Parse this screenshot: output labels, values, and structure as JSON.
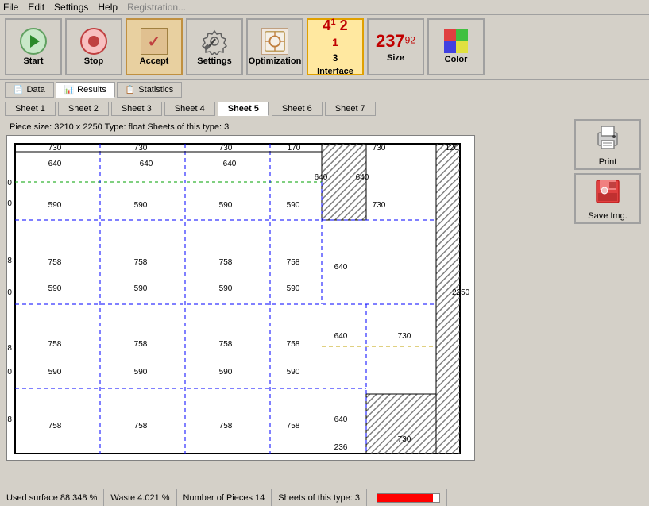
{
  "menu": {
    "items": [
      "File",
      "Edit",
      "Settings",
      "Help",
      "Registration..."
    ]
  },
  "toolbar": {
    "start": "Start",
    "stop": "Stop",
    "accept": "Accept",
    "settings": "Settings",
    "optimization": "Optimization",
    "interface": "Interface",
    "size": "Size",
    "color": "Color",
    "interface_numbers": "4 1 2\n1\n3"
  },
  "nav_tabs": {
    "items": [
      "Data",
      "Results",
      "Statistics"
    ]
  },
  "sheet_tabs": {
    "items": [
      "Sheet 1",
      "Sheet 2",
      "Sheet 3",
      "Sheet 4",
      "Sheet 5",
      "Sheet 6",
      "Sheet 7"
    ],
    "active": 4
  },
  "side_buttons": {
    "print": "Print",
    "save_img": "Save Img."
  },
  "diagram": {
    "piece_info": "Piece size: 3210 x 2250   Type: float   Sheets of this type: 3"
  },
  "statusbar": {
    "used_surface": "Used surface 88.348 %",
    "waste": "Waste 4.021 %",
    "number_pieces": "Number of Pieces 14",
    "sheets_of_type": "Sheets of this type: 3",
    "progress": 90
  }
}
